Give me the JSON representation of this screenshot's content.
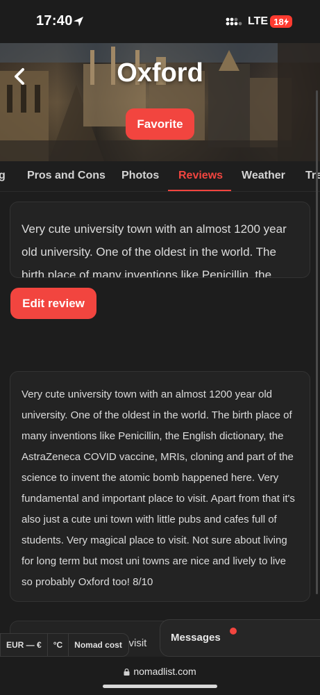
{
  "status_bar": {
    "time": "17:40",
    "network": "LTE",
    "battery": "18"
  },
  "header": {
    "title": "Oxford",
    "favorite_label": "Favorite"
  },
  "tabs": [
    {
      "label": "g"
    },
    {
      "label": "Pros and Cons"
    },
    {
      "label": "Photos"
    },
    {
      "label": "Reviews",
      "active": true
    },
    {
      "label": "Weather"
    },
    {
      "label": "Tre"
    }
  ],
  "own_review": {
    "text": "Very cute university town with an almost 1200 year old university. One of the oldest in the world. The birth place of many inventions like Penicillin, the",
    "edit_label": "Edit review"
  },
  "review": {
    "text": "Very cute university town with an almost 1200 year old university. One of the oldest in the world. The birth place of many inventions like Penicillin, the English dictionary, the AstraZeneca COVID vaccine, MRIs, cloning and part of the science to invent the atomic bomb happened here. Very fundamental and important place to visit. Apart from that it's also just a cute uni town with little pubs and cafes full of students. Very magical place to visit. Not sure about living for long term but most uni towns are nice and lively to live so probably Oxford too! 8/10"
  },
  "next_review_snippet": "o visit",
  "bottom_pills": {
    "currency": "EUR — €",
    "temperature": "°C",
    "cost": "Nomad cost"
  },
  "messages": {
    "label": "Messages"
  },
  "browser": {
    "url": "nomadlist.com"
  },
  "colors": {
    "accent": "#f2453f",
    "background": "#1d1d1d",
    "card": "#232323"
  }
}
